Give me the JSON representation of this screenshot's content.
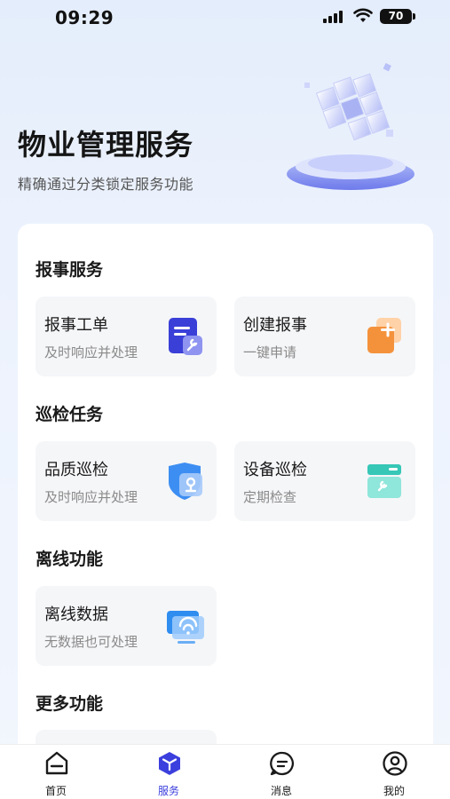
{
  "status_bar": {
    "time": "09:29",
    "battery": "70"
  },
  "header": {
    "title": "物业管理服务",
    "subtitle": "精确通过分类锁定服务功能"
  },
  "sections": [
    {
      "title": "报事服务",
      "items": [
        {
          "title": "报事工单",
          "desc": "及时响应并处理",
          "icon": "work-order-icon"
        },
        {
          "title": "创建报事",
          "desc": "一键申请",
          "icon": "create-report-icon"
        }
      ]
    },
    {
      "title": "巡检任务",
      "items": [
        {
          "title": "品质巡检",
          "desc": "及时响应并处理",
          "icon": "quality-inspection-icon"
        },
        {
          "title": "设备巡检",
          "desc": "定期检查",
          "icon": "equipment-inspection-icon"
        }
      ]
    },
    {
      "title": "离线功能",
      "items": [
        {
          "title": "离线数据",
          "desc": "无数据也可处理",
          "icon": "offline-data-icon"
        }
      ]
    },
    {
      "title": "更多功能",
      "items": []
    }
  ],
  "tabs": [
    {
      "label": "首页",
      "icon": "home-icon",
      "active": false
    },
    {
      "label": "服务",
      "icon": "service-cube-icon",
      "active": true
    },
    {
      "label": "消息",
      "icon": "message-icon",
      "active": false
    },
    {
      "label": "我的",
      "icon": "profile-icon",
      "active": false
    }
  ],
  "colors": {
    "accent": "#3b3fdd",
    "card_bg": "#ffffff",
    "tile_bg": "#f5f6f8"
  }
}
